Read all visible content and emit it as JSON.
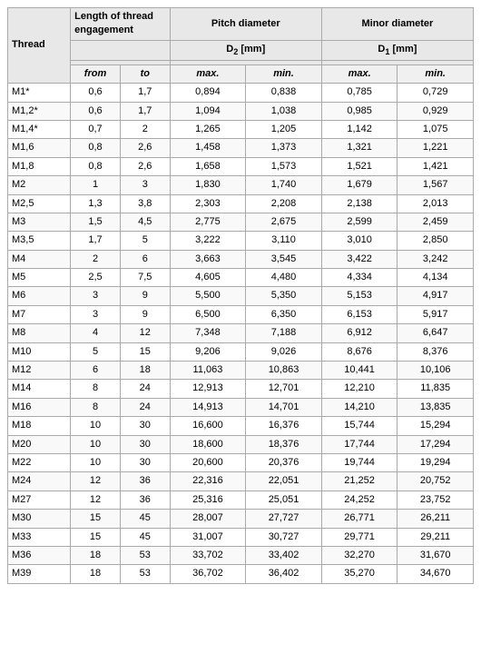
{
  "table": {
    "headers": {
      "thread": "Thread",
      "engagement": "Length of thread engagement",
      "pitch": "Pitch diameter",
      "minor": "Minor diameter",
      "d2": "D",
      "d2_sub": "2",
      "d2_unit": "[mm]",
      "d1": "D",
      "d1_sub": "1",
      "d1_unit": "[mm]",
      "from": "from",
      "to": "to",
      "max": "max.",
      "min": "min."
    },
    "rows": [
      {
        "thread": "M1*",
        "from": "0,6",
        "to": "1,7",
        "pitch_max": "0,894",
        "pitch_min": "0,838",
        "minor_max": "0,785",
        "minor_min": "0,729"
      },
      {
        "thread": "M1,2*",
        "from": "0,6",
        "to": "1,7",
        "pitch_max": "1,094",
        "pitch_min": "1,038",
        "minor_max": "0,985",
        "minor_min": "0,929"
      },
      {
        "thread": "M1,4*",
        "from": "0,7",
        "to": "2",
        "pitch_max": "1,265",
        "pitch_min": "1,205",
        "minor_max": "1,142",
        "minor_min": "1,075"
      },
      {
        "thread": "M1,6",
        "from": "0,8",
        "to": "2,6",
        "pitch_max": "1,458",
        "pitch_min": "1,373",
        "minor_max": "1,321",
        "minor_min": "1,221"
      },
      {
        "thread": "M1,8",
        "from": "0,8",
        "to": "2,6",
        "pitch_max": "1,658",
        "pitch_min": "1,573",
        "minor_max": "1,521",
        "minor_min": "1,421"
      },
      {
        "thread": "M2",
        "from": "1",
        "to": "3",
        "pitch_max": "1,830",
        "pitch_min": "1,740",
        "minor_max": "1,679",
        "minor_min": "1,567"
      },
      {
        "thread": "M2,5",
        "from": "1,3",
        "to": "3,8",
        "pitch_max": "2,303",
        "pitch_min": "2,208",
        "minor_max": "2,138",
        "minor_min": "2,013"
      },
      {
        "thread": "M3",
        "from": "1,5",
        "to": "4,5",
        "pitch_max": "2,775",
        "pitch_min": "2,675",
        "minor_max": "2,599",
        "minor_min": "2,459"
      },
      {
        "thread": "M3,5",
        "from": "1,7",
        "to": "5",
        "pitch_max": "3,222",
        "pitch_min": "3,110",
        "minor_max": "3,010",
        "minor_min": "2,850"
      },
      {
        "thread": "M4",
        "from": "2",
        "to": "6",
        "pitch_max": "3,663",
        "pitch_min": "3,545",
        "minor_max": "3,422",
        "minor_min": "3,242"
      },
      {
        "thread": "M5",
        "from": "2,5",
        "to": "7,5",
        "pitch_max": "4,605",
        "pitch_min": "4,480",
        "minor_max": "4,334",
        "minor_min": "4,134"
      },
      {
        "thread": "M6",
        "from": "3",
        "to": "9",
        "pitch_max": "5,500",
        "pitch_min": "5,350",
        "minor_max": "5,153",
        "minor_min": "4,917"
      },
      {
        "thread": "M7",
        "from": "3",
        "to": "9",
        "pitch_max": "6,500",
        "pitch_min": "6,350",
        "minor_max": "6,153",
        "minor_min": "5,917"
      },
      {
        "thread": "M8",
        "from": "4",
        "to": "12",
        "pitch_max": "7,348",
        "pitch_min": "7,188",
        "minor_max": "6,912",
        "minor_min": "6,647"
      },
      {
        "thread": "M10",
        "from": "5",
        "to": "15",
        "pitch_max": "9,206",
        "pitch_min": "9,026",
        "minor_max": "8,676",
        "minor_min": "8,376"
      },
      {
        "thread": "M12",
        "from": "6",
        "to": "18",
        "pitch_max": "11,063",
        "pitch_min": "10,863",
        "minor_max": "10,441",
        "minor_min": "10,106"
      },
      {
        "thread": "M14",
        "from": "8",
        "to": "24",
        "pitch_max": "12,913",
        "pitch_min": "12,701",
        "minor_max": "12,210",
        "minor_min": "11,835"
      },
      {
        "thread": "M16",
        "from": "8",
        "to": "24",
        "pitch_max": "14,913",
        "pitch_min": "14,701",
        "minor_max": "14,210",
        "minor_min": "13,835"
      },
      {
        "thread": "M18",
        "from": "10",
        "to": "30",
        "pitch_max": "16,600",
        "pitch_min": "16,376",
        "minor_max": "15,744",
        "minor_min": "15,294"
      },
      {
        "thread": "M20",
        "from": "10",
        "to": "30",
        "pitch_max": "18,600",
        "pitch_min": "18,376",
        "minor_max": "17,744",
        "minor_min": "17,294"
      },
      {
        "thread": "M22",
        "from": "10",
        "to": "30",
        "pitch_max": "20,600",
        "pitch_min": "20,376",
        "minor_max": "19,744",
        "minor_min": "19,294"
      },
      {
        "thread": "M24",
        "from": "12",
        "to": "36",
        "pitch_max": "22,316",
        "pitch_min": "22,051",
        "minor_max": "21,252",
        "minor_min": "20,752"
      },
      {
        "thread": "M27",
        "from": "12",
        "to": "36",
        "pitch_max": "25,316",
        "pitch_min": "25,051",
        "minor_max": "24,252",
        "minor_min": "23,752"
      },
      {
        "thread": "M30",
        "from": "15",
        "to": "45",
        "pitch_max": "28,007",
        "pitch_min": "27,727",
        "minor_max": "26,771",
        "minor_min": "26,211"
      },
      {
        "thread": "M33",
        "from": "15",
        "to": "45",
        "pitch_max": "31,007",
        "pitch_min": "30,727",
        "minor_max": "29,771",
        "minor_min": "29,211"
      },
      {
        "thread": "M36",
        "from": "18",
        "to": "53",
        "pitch_max": "33,702",
        "pitch_min": "33,402",
        "minor_max": "32,270",
        "minor_min": "31,670"
      },
      {
        "thread": "M39",
        "from": "18",
        "to": "53",
        "pitch_max": "36,702",
        "pitch_min": "36,402",
        "minor_max": "35,270",
        "minor_min": "34,670"
      }
    ]
  }
}
